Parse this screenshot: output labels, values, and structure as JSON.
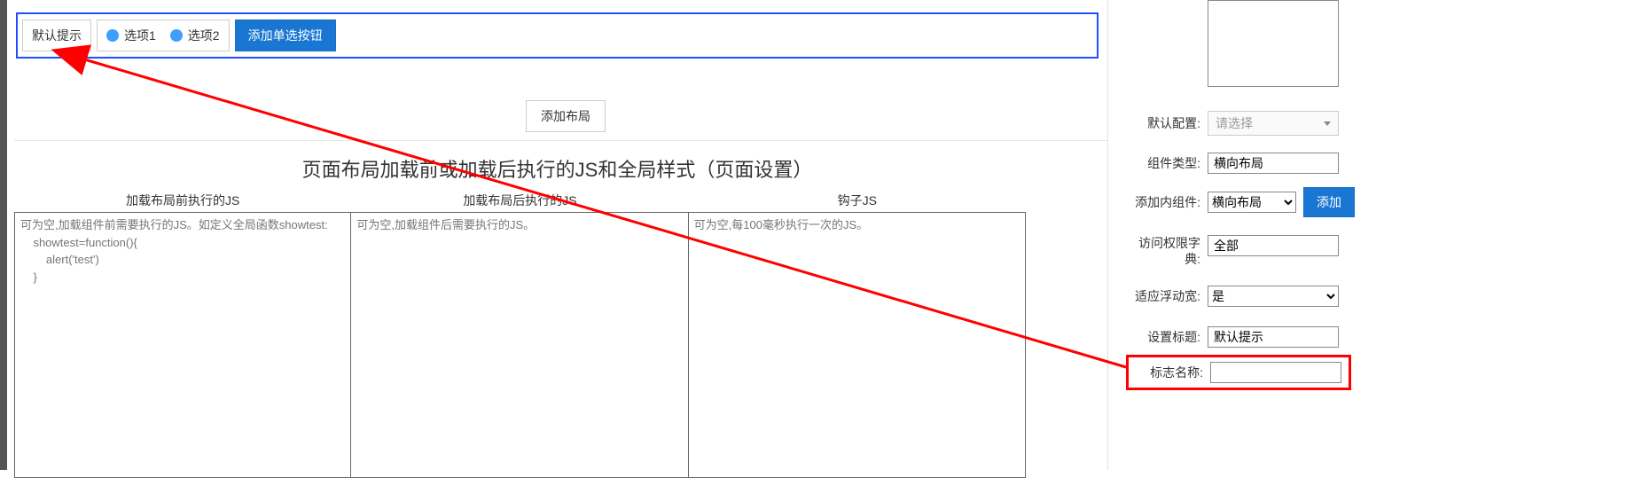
{
  "topBar": {
    "hintLabel": "默认提示",
    "radio1": "选项1",
    "radio2": "选项2",
    "addRadioBtn": "添加单选按钮"
  },
  "addLayoutBtn": "添加布局",
  "sectionTitle": "页面布局加载前或加载后执行的JS和全局样式（页面设置）",
  "jsCols": {
    "before": {
      "header": "加载布局前执行的JS",
      "placeholder": "可为空,加载组件前需要执行的JS。如定义全局函数showtest:\n    showtest=function(){\n        alert('test')\n    }"
    },
    "after": {
      "header": "加载布局后执行的JS",
      "placeholder": "可为空,加载组件后需要执行的JS。"
    },
    "hook": {
      "header": "钩子JS",
      "placeholder": "可为空,每100毫秒执行一次的JS。"
    }
  },
  "rightPanel": {
    "defaultConfig": {
      "label": "默认配置:",
      "placeholder": "请选择"
    },
    "componentType": {
      "label": "组件类型:",
      "value": "横向布局"
    },
    "innerComponent": {
      "label": "添加内组件:",
      "value": "横向布局",
      "addBtn": "添加"
    },
    "accessDict": {
      "label": "访问权限字典:",
      "value": "全部"
    },
    "floatWidth": {
      "label": "适应浮动宽:",
      "value": "是"
    },
    "setTitle": {
      "label": "设置标题:",
      "value": "默认提示"
    },
    "markName": {
      "label": "标志名称:",
      "value": ""
    }
  }
}
